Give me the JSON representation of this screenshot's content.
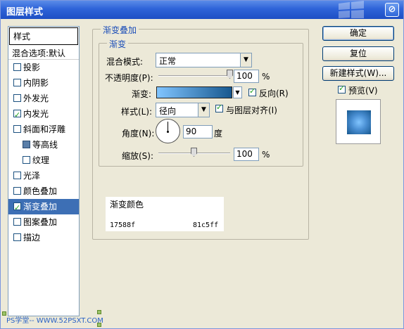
{
  "window": {
    "title": "图层样式"
  },
  "sidebar": {
    "header": "样式",
    "blend_row": "混合选项:默认",
    "items": [
      {
        "label": "投影",
        "checked": false
      },
      {
        "label": "内阴影",
        "checked": false
      },
      {
        "label": "外发光",
        "checked": false
      },
      {
        "label": "内发光",
        "checked": true
      },
      {
        "label": "斜面和浮雕",
        "checked": false
      },
      {
        "label": "等高线",
        "checked": false
      },
      {
        "label": "纹理",
        "checked": false
      },
      {
        "label": "光泽",
        "checked": false
      },
      {
        "label": "颜色叠加",
        "checked": false
      },
      {
        "label": "渐变叠加",
        "checked": true,
        "selected": true
      },
      {
        "label": "图案叠加",
        "checked": false
      },
      {
        "label": "描边",
        "checked": false
      }
    ]
  },
  "panel": {
    "group_title": "渐变叠加",
    "sub_title": "渐变",
    "blend_mode_label": "混合模式:",
    "blend_mode_value": "正常",
    "opacity_label": "不透明度(P):",
    "opacity_value": "100",
    "opacity_unit": "%",
    "opacity_level": 1.0,
    "gradient_label": "渐变:",
    "reverse_label": "反向(R)",
    "reverse_checked": true,
    "style_label": "样式(L):",
    "style_value": "径向",
    "align_label": "与图层对齐(I)",
    "align_checked": true,
    "angle_label": "角度(N):",
    "angle_value": "90",
    "angle_unit": "度",
    "scale_label": "缩放(S):",
    "scale_value": "100",
    "scale_unit": "%",
    "scale_level": 0.5
  },
  "note": {
    "title": "渐变颜色",
    "color_start": "17588f",
    "color_end": "81c5ff"
  },
  "buttons": {
    "ok": "确定",
    "reset": "复位",
    "new_style": "新建样式(W)...",
    "preview_label": "预览(V)",
    "preview_checked": true
  },
  "colors": {
    "gradient_start": "#17588f",
    "gradient_end": "#81c5ff",
    "selection": "#3d6fb5",
    "title_bar": "#2e63d8"
  },
  "watermark": "PS学堂-- WWW.52PSXT.COM"
}
